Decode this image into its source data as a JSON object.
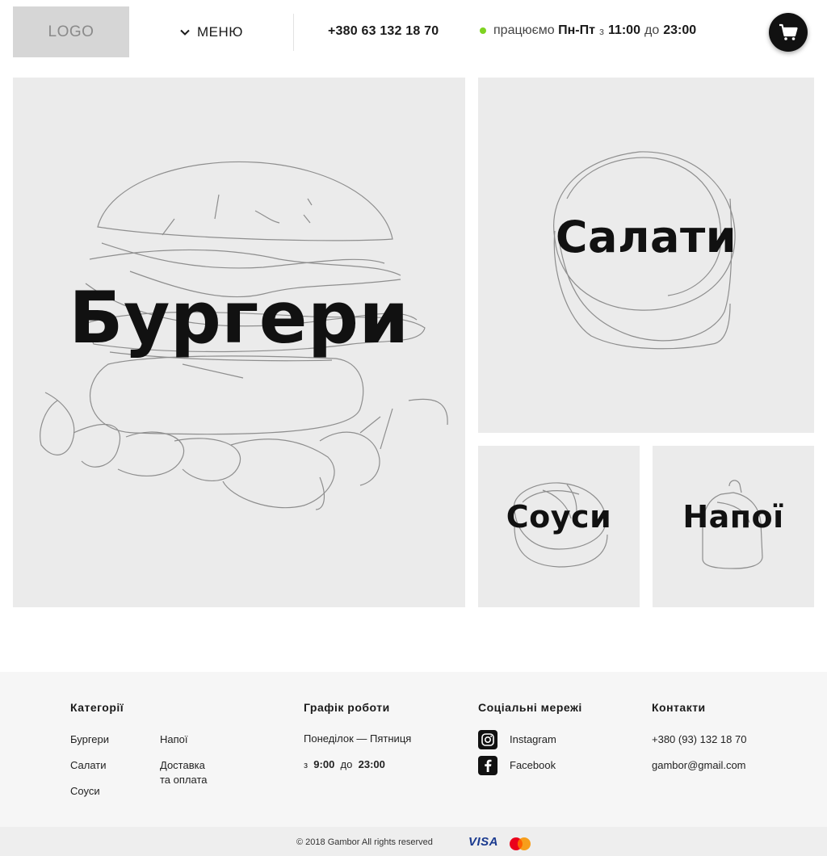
{
  "header": {
    "logo": "LOGO",
    "menu_label": "МЕНЮ",
    "phone": "+380 63 132 18 70",
    "hours": {
      "prefix": "працюємо",
      "days": "Пн-Пт",
      "from_word": "з",
      "open": "11:00",
      "to_word": "до",
      "close": "23:00",
      "status_color": "#7ed321"
    },
    "cart_icon": "cart-icon"
  },
  "categories": [
    {
      "label": "Бургери",
      "illustration": "burger-sketch"
    },
    {
      "label": "Салати",
      "illustration": "salad-bowl-sketch"
    },
    {
      "label": "Соуси",
      "illustration": "sauce-sketch"
    },
    {
      "label": "Напої",
      "illustration": "drink-sketch"
    }
  ],
  "footer": {
    "categories_title": "Категорії",
    "categories_links": [
      "Бургери",
      "Салати",
      "Соуси",
      "Напої",
      "Доставка",
      "та оплата"
    ],
    "schedule_title": "Графік роботи",
    "schedule_days": "Понеділок — Пятниця",
    "schedule_from": "з",
    "schedule_open": "9:00",
    "schedule_to": "до",
    "schedule_close": "23:00",
    "social_title": "Соціальні мережі",
    "social": [
      {
        "label": "Instagram",
        "icon": "instagram-icon"
      },
      {
        "label": "Facebook",
        "icon": "facebook-icon"
      }
    ],
    "contacts_title": "Контакти",
    "contacts_phone": "+380 (93) 132 18 70",
    "contacts_email": "gambor@gmail.com",
    "copyright": "© 2018 Gambor All rights reserved",
    "payment_visa": "VISA",
    "payment_mastercard": "mastercard-icon"
  }
}
